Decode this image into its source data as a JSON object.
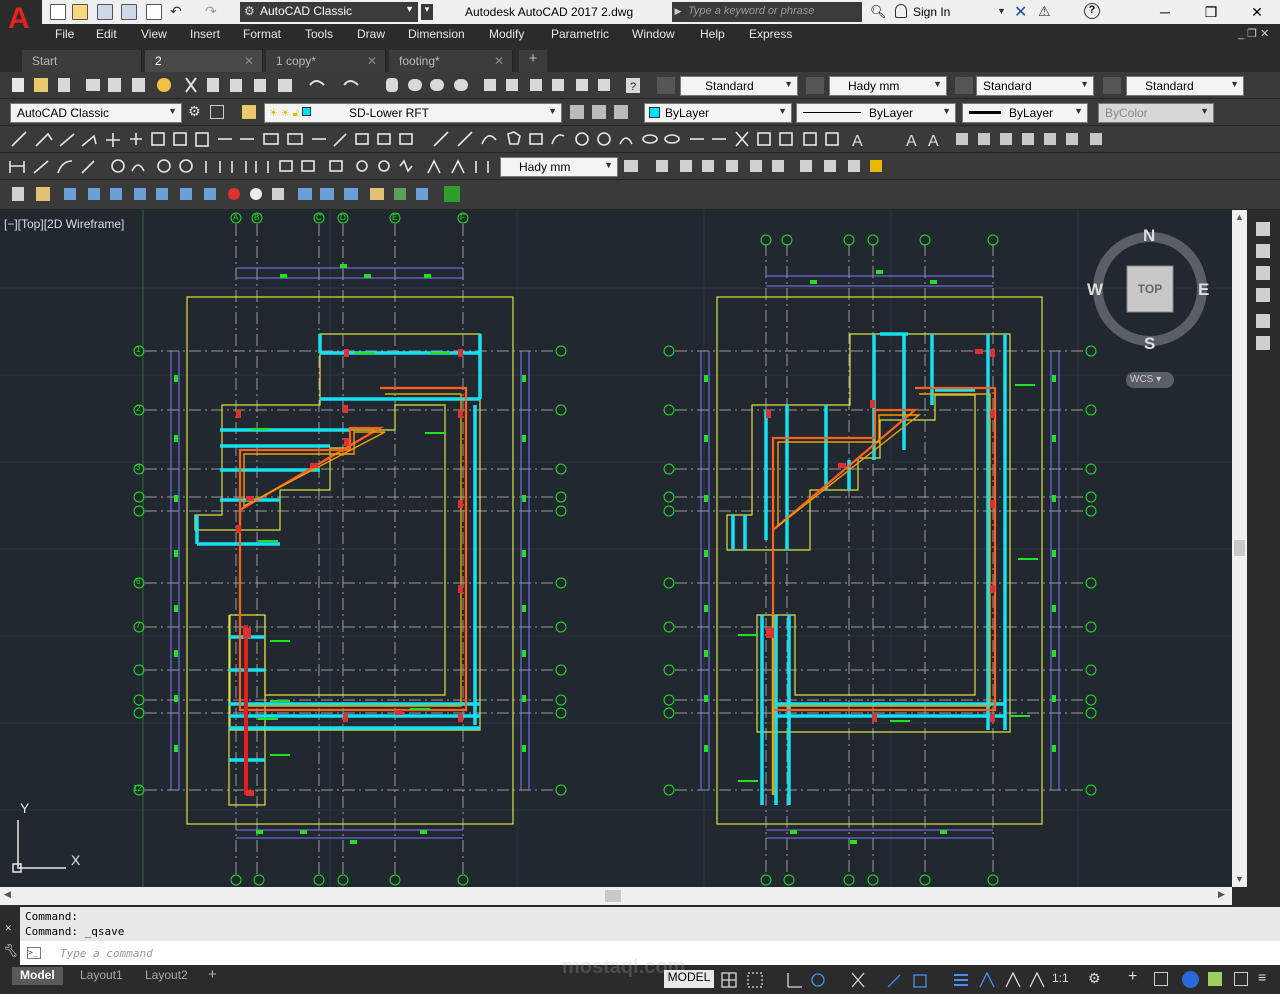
{
  "titlebar": {
    "workspace": "AutoCAD Classic",
    "title": "Autodesk AutoCAD 2017    2.dwg",
    "search_placeholder": "Type a keyword or phrase",
    "sign_in": "Sign In",
    "app_letter": "A"
  },
  "menu": [
    "File",
    "Edit",
    "View",
    "Insert",
    "Format",
    "Tools",
    "Draw",
    "Dimension",
    "Modify",
    "Parametric",
    "Window",
    "Help",
    "Express"
  ],
  "tabs": [
    "Start",
    "2",
    "1 copy*",
    "footing*"
  ],
  "toolbar": {
    "text_style": "Standard",
    "dim_style": "Hady mm",
    "table_style": "Standard",
    "mleader_style": "Standard",
    "workspace2": "AutoCAD Classic",
    "layer": "SD-Lower RFT",
    "color": "ByLayer",
    "linetype": "ByLayer",
    "lineweight": "ByLayer",
    "plotstyle": "ByColor",
    "dim_style2": "Hady mm"
  },
  "viewport": {
    "label": "[−][Top][2D Wireframe]",
    "viewcube": {
      "n": "N",
      "s": "S",
      "e": "E",
      "w": "W",
      "top": "TOP",
      "wcs": "WCS"
    },
    "ucs": {
      "x": "X",
      "y": "Y"
    },
    "grid_letters": [
      "A",
      "B",
      "C",
      "D",
      "E",
      "F"
    ],
    "grid_numbers": [
      "1",
      "2",
      "3",
      "4",
      "5",
      "6",
      "7",
      "8",
      "9",
      "10",
      "11",
      "12"
    ]
  },
  "command": {
    "history": [
      "Command:",
      "Command:  _qsave"
    ],
    "placeholder": "Type a command"
  },
  "status": {
    "layouts": [
      "Model",
      "Layout1",
      "Layout2"
    ],
    "model": "MODEL",
    "scale": "1:1"
  },
  "watermark": "mostaql.com"
}
